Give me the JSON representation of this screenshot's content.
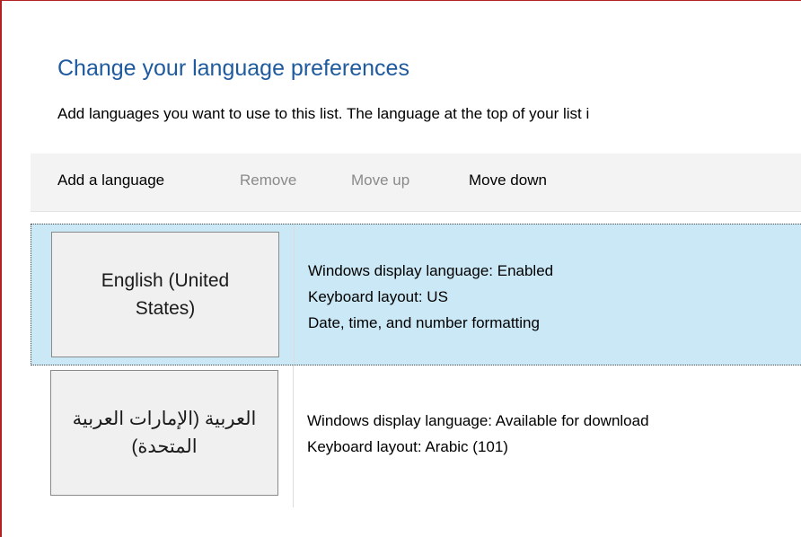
{
  "page": {
    "title": "Change your language preferences",
    "intro": "Add languages you want to use to this list. The language at the top of your list i"
  },
  "toolbar": {
    "add_label": "Add a language",
    "remove_label": "Remove",
    "move_up_label": "Move up",
    "move_down_label": "Move down"
  },
  "languages": [
    {
      "name": "English (United States)",
      "selected": true,
      "details": [
        "Windows display language: Enabled",
        "Keyboard layout: US",
        "Date, time, and number formatting"
      ]
    },
    {
      "name": "العربية (الإمارات العربية المتحدة)",
      "selected": false,
      "details": [
        "Windows display language: Available for download",
        "Keyboard layout: Arabic (101)"
      ]
    }
  ],
  "colors": {
    "title": "#1e5a9e",
    "selected_row": "#cbe8f6",
    "toolbar_bg": "#f3f3f3",
    "disabled_text": "#8a8a8a",
    "frame_border": "#b22222"
  }
}
